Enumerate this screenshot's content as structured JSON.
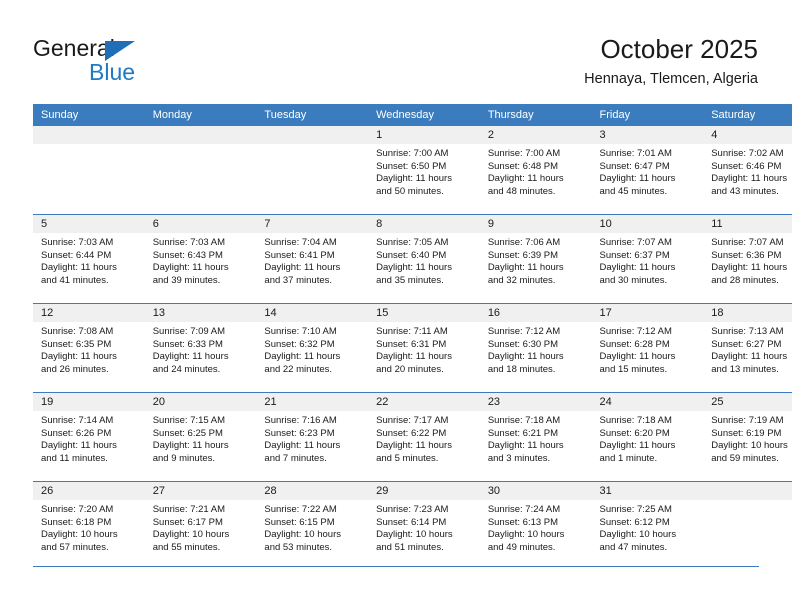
{
  "brand": {
    "name_top": "General",
    "name_bottom": "Blue",
    "triangle_color": "#1e6fb8",
    "blue_color": "#1f7ac4"
  },
  "header": {
    "month_year": "October 2025",
    "location": "Hennaya, Tlemcen, Algeria"
  },
  "theme": {
    "header_bar_color": "#3a7cbe",
    "daynum_band_color": "#f0f0f0",
    "grid_line_color": "#3a7cbe",
    "text_color": "#1a1a1a"
  },
  "weekday_headers": [
    "Sunday",
    "Monday",
    "Tuesday",
    "Wednesday",
    "Thursday",
    "Friday",
    "Saturday"
  ],
  "labels": {
    "sunrise_prefix": "Sunrise:",
    "sunset_prefix": "Sunset:",
    "daylight_prefix": "Daylight:"
  },
  "weeks": [
    [
      {
        "day": "",
        "empty": true,
        "sunrise": "",
        "sunset": "",
        "daylight_line1": "",
        "daylight_line2": ""
      },
      {
        "day": "",
        "empty": true,
        "sunrise": "",
        "sunset": "",
        "daylight_line1": "",
        "daylight_line2": ""
      },
      {
        "day": "",
        "empty": true,
        "sunrise": "",
        "sunset": "",
        "daylight_line1": "",
        "daylight_line2": ""
      },
      {
        "day": "1",
        "empty": false,
        "sunrise": "Sunrise: 7:00 AM",
        "sunset": "Sunset: 6:50 PM",
        "daylight_line1": "Daylight: 11 hours",
        "daylight_line2": "and 50 minutes."
      },
      {
        "day": "2",
        "empty": false,
        "sunrise": "Sunrise: 7:00 AM",
        "sunset": "Sunset: 6:48 PM",
        "daylight_line1": "Daylight: 11 hours",
        "daylight_line2": "and 48 minutes."
      },
      {
        "day": "3",
        "empty": false,
        "sunrise": "Sunrise: 7:01 AM",
        "sunset": "Sunset: 6:47 PM",
        "daylight_line1": "Daylight: 11 hours",
        "daylight_line2": "and 45 minutes."
      },
      {
        "day": "4",
        "empty": false,
        "sunrise": "Sunrise: 7:02 AM",
        "sunset": "Sunset: 6:46 PM",
        "daylight_line1": "Daylight: 11 hours",
        "daylight_line2": "and 43 minutes."
      }
    ],
    [
      {
        "day": "5",
        "empty": false,
        "sunrise": "Sunrise: 7:03 AM",
        "sunset": "Sunset: 6:44 PM",
        "daylight_line1": "Daylight: 11 hours",
        "daylight_line2": "and 41 minutes."
      },
      {
        "day": "6",
        "empty": false,
        "sunrise": "Sunrise: 7:03 AM",
        "sunset": "Sunset: 6:43 PM",
        "daylight_line1": "Daylight: 11 hours",
        "daylight_line2": "and 39 minutes."
      },
      {
        "day": "7",
        "empty": false,
        "sunrise": "Sunrise: 7:04 AM",
        "sunset": "Sunset: 6:41 PM",
        "daylight_line1": "Daylight: 11 hours",
        "daylight_line2": "and 37 minutes."
      },
      {
        "day": "8",
        "empty": false,
        "sunrise": "Sunrise: 7:05 AM",
        "sunset": "Sunset: 6:40 PM",
        "daylight_line1": "Daylight: 11 hours",
        "daylight_line2": "and 35 minutes."
      },
      {
        "day": "9",
        "empty": false,
        "sunrise": "Sunrise: 7:06 AM",
        "sunset": "Sunset: 6:39 PM",
        "daylight_line1": "Daylight: 11 hours",
        "daylight_line2": "and 32 minutes."
      },
      {
        "day": "10",
        "empty": false,
        "sunrise": "Sunrise: 7:07 AM",
        "sunset": "Sunset: 6:37 PM",
        "daylight_line1": "Daylight: 11 hours",
        "daylight_line2": "and 30 minutes."
      },
      {
        "day": "11",
        "empty": false,
        "sunrise": "Sunrise: 7:07 AM",
        "sunset": "Sunset: 6:36 PM",
        "daylight_line1": "Daylight: 11 hours",
        "daylight_line2": "and 28 minutes."
      }
    ],
    [
      {
        "day": "12",
        "empty": false,
        "sunrise": "Sunrise: 7:08 AM",
        "sunset": "Sunset: 6:35 PM",
        "daylight_line1": "Daylight: 11 hours",
        "daylight_line2": "and 26 minutes."
      },
      {
        "day": "13",
        "empty": false,
        "sunrise": "Sunrise: 7:09 AM",
        "sunset": "Sunset: 6:33 PM",
        "daylight_line1": "Daylight: 11 hours",
        "daylight_line2": "and 24 minutes."
      },
      {
        "day": "14",
        "empty": false,
        "sunrise": "Sunrise: 7:10 AM",
        "sunset": "Sunset: 6:32 PM",
        "daylight_line1": "Daylight: 11 hours",
        "daylight_line2": "and 22 minutes."
      },
      {
        "day": "15",
        "empty": false,
        "sunrise": "Sunrise: 7:11 AM",
        "sunset": "Sunset: 6:31 PM",
        "daylight_line1": "Daylight: 11 hours",
        "daylight_line2": "and 20 minutes."
      },
      {
        "day": "16",
        "empty": false,
        "sunrise": "Sunrise: 7:12 AM",
        "sunset": "Sunset: 6:30 PM",
        "daylight_line1": "Daylight: 11 hours",
        "daylight_line2": "and 18 minutes."
      },
      {
        "day": "17",
        "empty": false,
        "sunrise": "Sunrise: 7:12 AM",
        "sunset": "Sunset: 6:28 PM",
        "daylight_line1": "Daylight: 11 hours",
        "daylight_line2": "and 15 minutes."
      },
      {
        "day": "18",
        "empty": false,
        "sunrise": "Sunrise: 7:13 AM",
        "sunset": "Sunset: 6:27 PM",
        "daylight_line1": "Daylight: 11 hours",
        "daylight_line2": "and 13 minutes."
      }
    ],
    [
      {
        "day": "19",
        "empty": false,
        "sunrise": "Sunrise: 7:14 AM",
        "sunset": "Sunset: 6:26 PM",
        "daylight_line1": "Daylight: 11 hours",
        "daylight_line2": "and 11 minutes."
      },
      {
        "day": "20",
        "empty": false,
        "sunrise": "Sunrise: 7:15 AM",
        "sunset": "Sunset: 6:25 PM",
        "daylight_line1": "Daylight: 11 hours",
        "daylight_line2": "and 9 minutes."
      },
      {
        "day": "21",
        "empty": false,
        "sunrise": "Sunrise: 7:16 AM",
        "sunset": "Sunset: 6:23 PM",
        "daylight_line1": "Daylight: 11 hours",
        "daylight_line2": "and 7 minutes."
      },
      {
        "day": "22",
        "empty": false,
        "sunrise": "Sunrise: 7:17 AM",
        "sunset": "Sunset: 6:22 PM",
        "daylight_line1": "Daylight: 11 hours",
        "daylight_line2": "and 5 minutes."
      },
      {
        "day": "23",
        "empty": false,
        "sunrise": "Sunrise: 7:18 AM",
        "sunset": "Sunset: 6:21 PM",
        "daylight_line1": "Daylight: 11 hours",
        "daylight_line2": "and 3 minutes."
      },
      {
        "day": "24",
        "empty": false,
        "sunrise": "Sunrise: 7:18 AM",
        "sunset": "Sunset: 6:20 PM",
        "daylight_line1": "Daylight: 11 hours",
        "daylight_line2": "and 1 minute."
      },
      {
        "day": "25",
        "empty": false,
        "sunrise": "Sunrise: 7:19 AM",
        "sunset": "Sunset: 6:19 PM",
        "daylight_line1": "Daylight: 10 hours",
        "daylight_line2": "and 59 minutes."
      }
    ],
    [
      {
        "day": "26",
        "empty": false,
        "sunrise": "Sunrise: 7:20 AM",
        "sunset": "Sunset: 6:18 PM",
        "daylight_line1": "Daylight: 10 hours",
        "daylight_line2": "and 57 minutes."
      },
      {
        "day": "27",
        "empty": false,
        "sunrise": "Sunrise: 7:21 AM",
        "sunset": "Sunset: 6:17 PM",
        "daylight_line1": "Daylight: 10 hours",
        "daylight_line2": "and 55 minutes."
      },
      {
        "day": "28",
        "empty": false,
        "sunrise": "Sunrise: 7:22 AM",
        "sunset": "Sunset: 6:15 PM",
        "daylight_line1": "Daylight: 10 hours",
        "daylight_line2": "and 53 minutes."
      },
      {
        "day": "29",
        "empty": false,
        "sunrise": "Sunrise: 7:23 AM",
        "sunset": "Sunset: 6:14 PM",
        "daylight_line1": "Daylight: 10 hours",
        "daylight_line2": "and 51 minutes."
      },
      {
        "day": "30",
        "empty": false,
        "sunrise": "Sunrise: 7:24 AM",
        "sunset": "Sunset: 6:13 PM",
        "daylight_line1": "Daylight: 10 hours",
        "daylight_line2": "and 49 minutes."
      },
      {
        "day": "31",
        "empty": false,
        "sunrise": "Sunrise: 7:25 AM",
        "sunset": "Sunset: 6:12 PM",
        "daylight_line1": "Daylight: 10 hours",
        "daylight_line2": "and 47 minutes."
      },
      {
        "day": "",
        "empty": true,
        "sunrise": "",
        "sunset": "",
        "daylight_line1": "",
        "daylight_line2": ""
      }
    ]
  ]
}
